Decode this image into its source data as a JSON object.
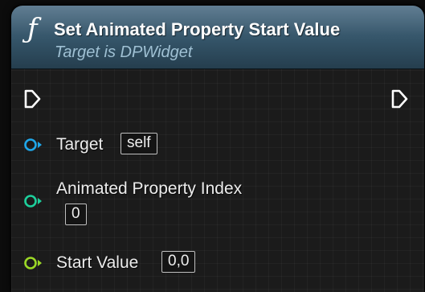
{
  "node": {
    "icon": "function-icon",
    "title": "Set Animated Property Start Value",
    "subtitle": "Target is DPWidget",
    "header_color": "#345468"
  },
  "pins": {
    "exec_in": {
      "icon": "exec-pin-icon"
    },
    "exec_out": {
      "icon": "exec-pin-icon"
    },
    "target": {
      "label": "Target",
      "value": "self",
      "color": "#1fa6e8"
    },
    "index": {
      "label": "Animated Property Index",
      "value": "0",
      "color": "#1dcf9b"
    },
    "start_value": {
      "label": "Start Value",
      "value": "0,0",
      "color": "#9bd826"
    }
  }
}
